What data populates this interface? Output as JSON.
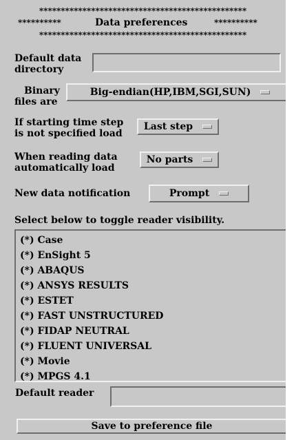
{
  "header": {
    "line1": "************************************************",
    "line2_left": "**********",
    "title": "Data preferences",
    "line2_right": "**********",
    "line3": "************************************************"
  },
  "default_data_directory": {
    "label_line1": "Default data",
    "label_line2": "directory",
    "value": ""
  },
  "binary_files": {
    "label_line1": "Binary",
    "label_line2": "files are",
    "selected": "Big-endian(HP,IBM,SGI,SUN)"
  },
  "starting_time_step": {
    "label_line1": "If starting time step",
    "label_line2": "is not specified load",
    "selected": "Last step"
  },
  "when_reading": {
    "label_line1": "When reading data",
    "label_line2": "automatically load",
    "selected": "No parts"
  },
  "new_data_notification": {
    "label": "New data notification",
    "selected": "Prompt"
  },
  "reader_list": {
    "caption": "Select below to toggle reader visibility.",
    "items": [
      "(*) Case",
      "(*) EnSight 5",
      "(*) ABAQUS",
      "(*) ANSYS RESULTS",
      "(*) ESTET",
      "(*) FAST UNSTRUCTURED",
      "(*) FIDAP NEUTRAL",
      "(*) FLUENT UNIVERSAL",
      "(*) Movie",
      "(*) MPGS 4.1"
    ]
  },
  "default_reader": {
    "label": "Default reader",
    "value": ""
  },
  "save_button": {
    "label": "Save to preference file"
  },
  "colors": {
    "panel_bg": "#c8c8c8",
    "highlight": "#f0f0f0",
    "shadow": "#6e6e6e"
  }
}
